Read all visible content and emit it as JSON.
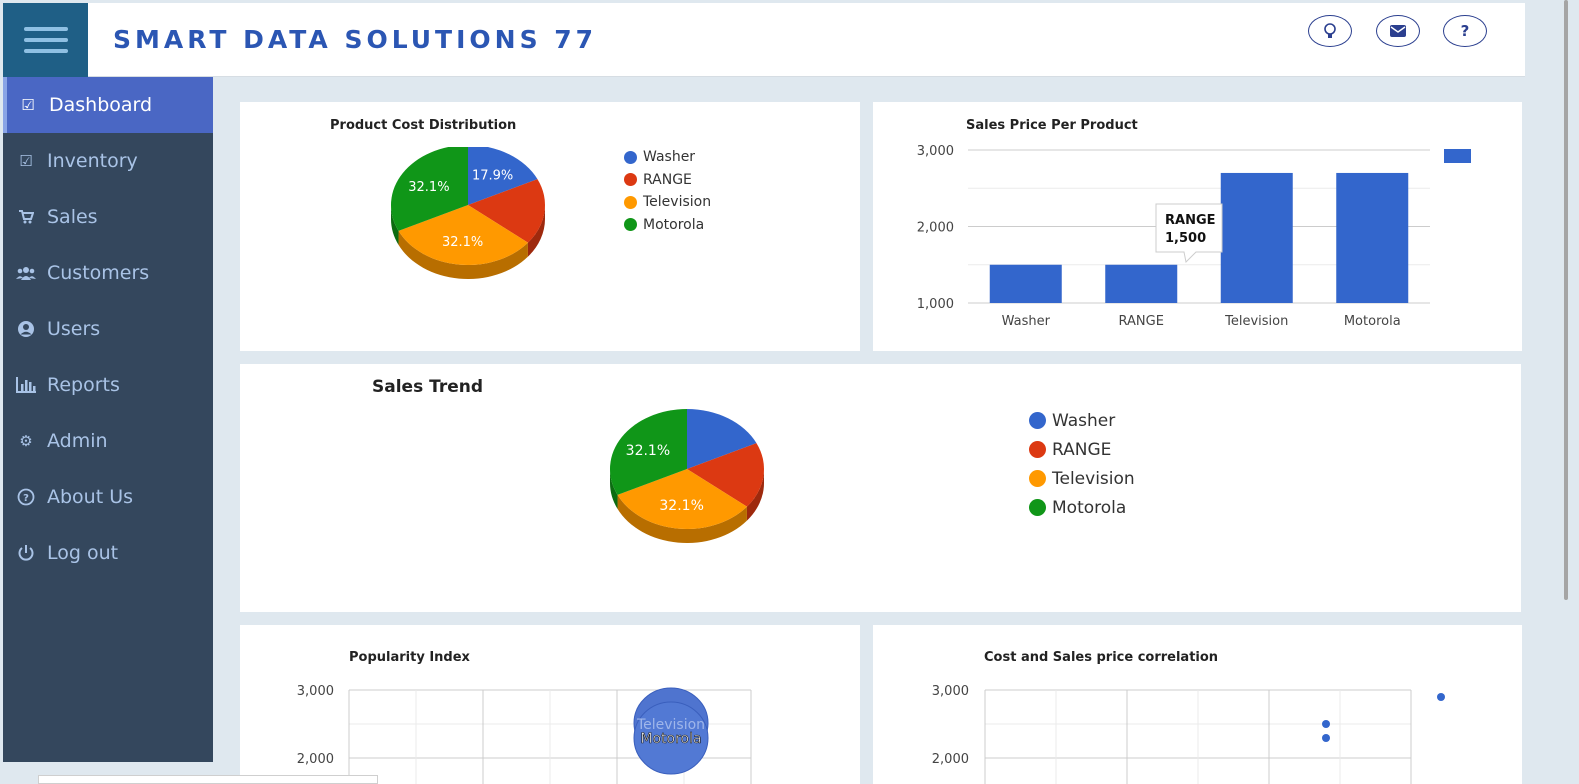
{
  "header": {
    "title": "SMART DATA SOLUTIONS 77",
    "icons": [
      {
        "name": "lightbulb-icon",
        "glyph": "💡"
      },
      {
        "name": "mail-icon",
        "glyph": "✉"
      },
      {
        "name": "help-icon",
        "glyph": "?"
      }
    ]
  },
  "sidebar": {
    "items": [
      {
        "label": "Dashboard",
        "icon": "check-square-icon",
        "glyph": "☑",
        "active": true
      },
      {
        "label": "Inventory",
        "icon": "check-square-icon",
        "glyph": "☑",
        "active": false
      },
      {
        "label": "Sales",
        "icon": "cart-icon",
        "glyph": "🛒",
        "active": false
      },
      {
        "label": "Customers",
        "icon": "users-icon",
        "glyph": "👥",
        "active": false
      },
      {
        "label": "Users",
        "icon": "user-circle-icon",
        "glyph": "◉",
        "active": false
      },
      {
        "label": "Reports",
        "icon": "bar-chart-icon",
        "glyph": "▥",
        "active": false
      },
      {
        "label": "Admin",
        "icon": "gears-icon",
        "glyph": "⚙",
        "active": false
      },
      {
        "label": "About Us",
        "icon": "question-circle-icon",
        "glyph": "?",
        "active": false
      },
      {
        "label": "Log out",
        "icon": "power-icon",
        "glyph": "⏻",
        "active": false
      }
    ]
  },
  "colors": {
    "blue": "#3366cc",
    "red": "#dc3912",
    "orange": "#ff9900",
    "green": "#109618"
  },
  "chart_data": [
    {
      "type": "pie",
      "title": "Product Cost Distribution",
      "categories": [
        "Washer",
        "RANGE",
        "Television",
        "Motorola"
      ],
      "values": [
        17.9,
        17.9,
        32.1,
        32.1
      ],
      "slice_labels": [
        "17.9%",
        "",
        "32.1%",
        "32.1%"
      ],
      "legend_position": "right",
      "style": "3d"
    },
    {
      "type": "bar",
      "title": "Sales Price Per Product",
      "categories": [
        "Washer",
        "RANGE",
        "Television",
        "Motorola"
      ],
      "values": [
        1500,
        1500,
        2700,
        2700
      ],
      "y_ticks": [
        "1,000",
        "2,000",
        "3,000"
      ],
      "ylim": [
        1000,
        3000
      ],
      "tooltip": {
        "category": "RANGE",
        "value": "1,500"
      },
      "legend_position": "right"
    },
    {
      "type": "pie",
      "title": "Sales Trend",
      "categories": [
        "Washer",
        "RANGE",
        "Television",
        "Motorola"
      ],
      "values": [
        17.9,
        17.9,
        32.1,
        32.1
      ],
      "slice_labels": [
        "",
        "",
        "32.1%",
        "32.1%"
      ],
      "legend_position": "right",
      "style": "3d"
    },
    {
      "type": "scatter",
      "title": "Popularity Index",
      "y_ticks": [
        "2,000",
        "3,000"
      ],
      "bubble_labels": [
        "Television",
        "Motorola"
      ]
    },
    {
      "type": "scatter",
      "title": "Cost and Sales price correlation",
      "y_ticks": [
        "2,000",
        "3,000"
      ]
    }
  ]
}
